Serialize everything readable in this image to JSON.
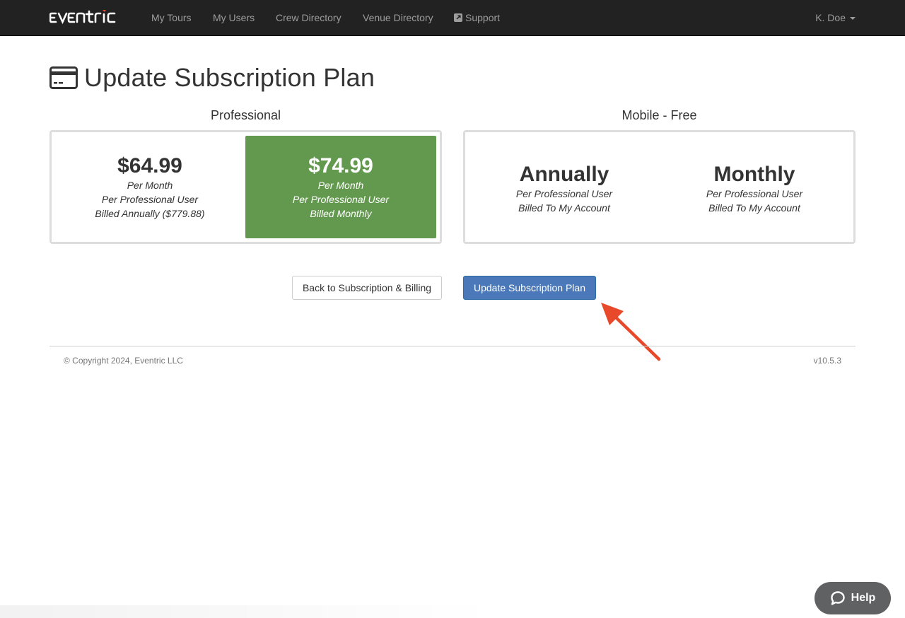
{
  "nav": {
    "brand": "eventric",
    "items": [
      "My Tours",
      "My Users",
      "Crew Directory",
      "Venue Directory"
    ],
    "support": "Support",
    "user": "K. Doe"
  },
  "page": {
    "title": "Update Subscription Plan"
  },
  "professional": {
    "title": "Professional",
    "options": [
      {
        "price": "$64.99",
        "line1": "Per Month",
        "line2": "Per Professional User",
        "line3": "Billed Annually ($779.88)",
        "selected": false
      },
      {
        "price": "$74.99",
        "line1": "Per Month",
        "line2": "Per Professional User",
        "line3": "Billed Monthly",
        "selected": true
      }
    ]
  },
  "mobile": {
    "title": "Mobile - Free",
    "options": [
      {
        "name": "Annually",
        "line1": "Per Professional User",
        "line2": "Billed To My Account"
      },
      {
        "name": "Monthly",
        "line1": "Per Professional User",
        "line2": "Billed To My Account"
      }
    ]
  },
  "buttons": {
    "back": "Back to Subscription & Billing",
    "update": "Update Subscription Plan"
  },
  "footer": {
    "copyright": "© Copyright 2024, Eventric LLC",
    "version": "v10.5.3"
  },
  "help": {
    "label": "Help"
  },
  "colors": {
    "navbar": "#222222",
    "selected_plan": "#63994e",
    "primary_button": "#4a78b8",
    "annotation_arrow": "#e8492a",
    "help_button": "#5f6163"
  }
}
